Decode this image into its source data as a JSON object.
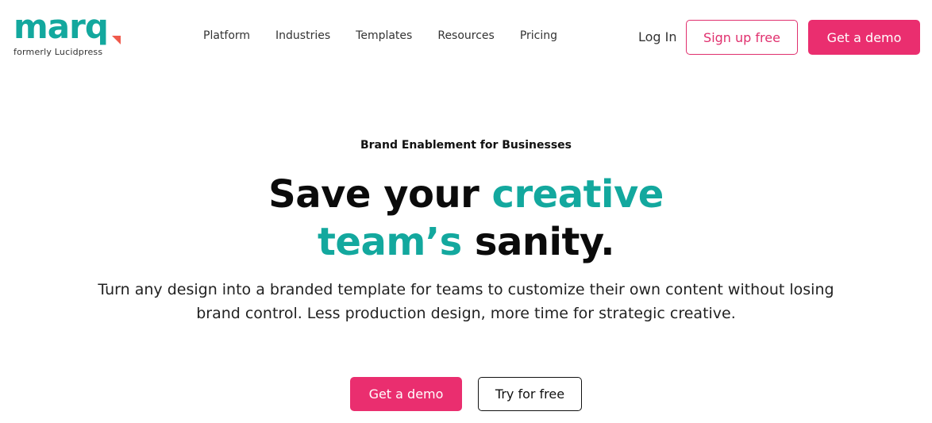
{
  "brand": {
    "logo_text": "marq",
    "tagline": "formerly Lucidpress",
    "primary_color": "#13a89e",
    "accent_color": "#ea2e6f",
    "logo_mark_color": "#ef5a4c"
  },
  "nav": {
    "items": [
      {
        "label": "Platform"
      },
      {
        "label": "Industries"
      },
      {
        "label": "Templates"
      },
      {
        "label": "Resources"
      },
      {
        "label": "Pricing"
      }
    ],
    "login_label": "Log In",
    "signup_label": "Sign up free",
    "demo_label": "Get a demo"
  },
  "hero": {
    "eyebrow": "Brand Enablement for Businesses",
    "headline_part1": "Save your ",
    "headline_accent1": "creative",
    "headline_accent2": "team’s",
    "headline_part2": " sanity.",
    "description": "Turn any design into a branded template for teams to customize their own content without losing brand control. Less production design, more time for strategic creative.",
    "primary_cta": "Get a demo",
    "secondary_cta": "Try for free"
  }
}
